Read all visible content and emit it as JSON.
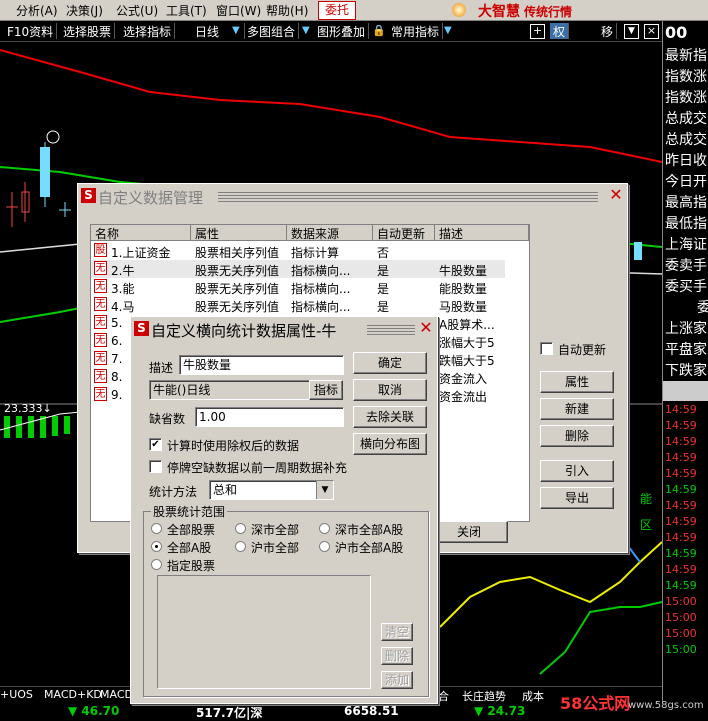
{
  "menu": {
    "items": [
      "分析(A)",
      "决策(J)",
      "公式(U)",
      "工具(T)",
      "窗口(W)",
      "帮助(H)"
    ],
    "entrust": "委托",
    "brand": "大智慧",
    "brand_sub": "传统行情"
  },
  "toolbar": {
    "items": [
      "F10资料",
      "选择股票",
      "选择指标",
      "日线",
      "多图组合",
      "图形叠加",
      "常用指标",
      "权",
      "移"
    ],
    "items_sel": "选择指标"
  },
  "right_panel": {
    "top": "00",
    "labels": [
      "最新指",
      "指数涨",
      "指数涨",
      "总成交",
      "总成交",
      "昨日收",
      "今日开",
      "最高指",
      "最低指",
      "上海证",
      "委卖手",
      "委买手",
      "委",
      "上涨家",
      "平盘家",
      "下跌家"
    ],
    "ticks": [
      "14:59",
      "14:59",
      "14:59",
      "14:59",
      "14:59",
      "14:59",
      "14:59",
      "14:59",
      "14:59",
      "14:59",
      "14:59",
      "14:59",
      "15:00",
      "15:00",
      "15:00",
      "15:00"
    ]
  },
  "chart": {
    "value_label": "23.333↓",
    "legend_right_1": "能",
    "legend_right_2": "区"
  },
  "bottom_tabs": [
    "+UOS",
    "MACD+KD",
    "MACD",
    "合",
    "长庄趋势",
    "成本"
  ],
  "status": {
    "v1": "▼ 46.70",
    "v2": "517.7亿|深",
    "v3": "6658.51",
    "v4": "▼ 24.73",
    "watermark": "58公式网",
    "watermark_url": "www.58gs.com"
  },
  "dialog_main": {
    "title": "自定义数据管理",
    "columns": [
      "名称",
      "属性",
      "数据来源",
      "自动更新",
      "描述"
    ],
    "rows": [
      {
        "badge": "股",
        "name": "1.上证资金",
        "attr": "股票相关序列值",
        "source": "指标计算",
        "auto": "否",
        "desc": ""
      },
      {
        "badge": "无",
        "name": "2.牛",
        "attr": "股票无关序列值",
        "source": "指标横向...",
        "auto": "是",
        "desc": "牛股数量"
      },
      {
        "badge": "无",
        "name": "3.能",
        "attr": "股票无关序列值",
        "source": "指标横向...",
        "auto": "是",
        "desc": "能股数量"
      },
      {
        "badge": "无",
        "name": "4.马",
        "attr": "股票无关序列值",
        "source": "指标横向...",
        "auto": "是",
        "desc": "马股数量"
      },
      {
        "badge": "无",
        "name": "5.",
        "attr": "",
        "source": "",
        "auto": "",
        "desc": "A股算术..."
      },
      {
        "badge": "无",
        "name": "6.",
        "attr": "",
        "source": "",
        "auto": "",
        "desc": "涨幅大于5"
      },
      {
        "badge": "无",
        "name": "7.",
        "attr": "",
        "source": "",
        "auto": "",
        "desc": "跌幅大于5"
      },
      {
        "badge": "无",
        "name": "8.",
        "attr": "",
        "source": "",
        "auto": "",
        "desc": "资金流入"
      },
      {
        "badge": "无",
        "name": "9.",
        "attr": "",
        "source": "",
        "auto": "",
        "desc": "资金流出"
      }
    ],
    "auto_update_label": "自动更新",
    "buttons": {
      "props": "属性",
      "new": "新建",
      "delete": "删除",
      "import": "引入",
      "export": "导出",
      "close": "关闭"
    }
  },
  "dialog_prop": {
    "title": "自定义横向统计数据属性-牛",
    "desc_label": "描述",
    "desc_value": "牛股数量",
    "formula_value": "牛能()日线",
    "indicator_btn": "指标",
    "default_label": "缺省数",
    "default_value": "1.00",
    "ok": "确定",
    "cancel": "取消",
    "remove_link": "去除关联",
    "dist_chart": "横向分布图",
    "chk_adjusted": "计算时使用除权后的数据",
    "chk_adjusted_on": true,
    "chk_fill": "停牌空缺数据以前一周期数据补充",
    "stat_label": "统计方法",
    "stat_value": "总和",
    "range_title": "股票统计范围",
    "radios": [
      "全部股票",
      "深市全部",
      "深市全部A股",
      "全部A股",
      "沪市全部",
      "沪市全部A股",
      "指定股票"
    ],
    "radio_selected": "全部A股",
    "list_btns": {
      "clear": "清空",
      "del": "删除",
      "add": "添加"
    }
  }
}
